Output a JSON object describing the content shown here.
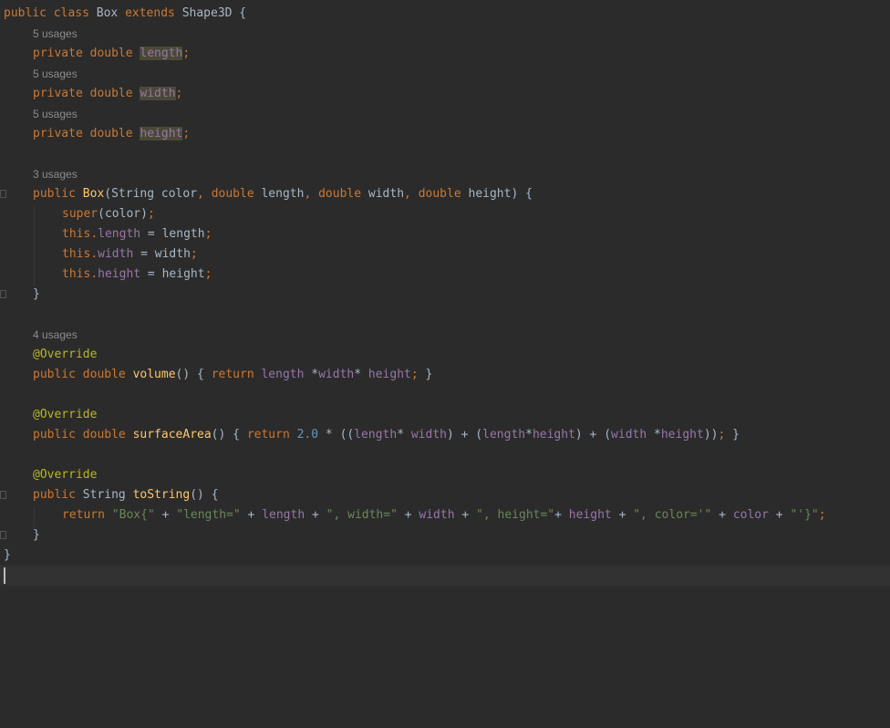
{
  "editor": {
    "language": "Java",
    "lines": {
      "class_decl": {
        "kw1": "public class ",
        "name": "Box ",
        "kw2": "extends ",
        "parent": "Shape3D {"
      },
      "hint_length": "5 usages",
      "field_length": {
        "kw": "private double ",
        "name": "length",
        "semi": ";"
      },
      "hint_width": "5 usages",
      "field_width": {
        "kw": "private double ",
        "name": "width",
        "semi": ";"
      },
      "hint_height": "5 usages",
      "field_height": {
        "kw": "private double ",
        "name": "height",
        "semi": ";"
      },
      "hint_ctor": "3 usages",
      "ctor_decl": {
        "kw": "public ",
        "name": "Box",
        "p1": "(String color",
        "c1": ", ",
        "k1": "double ",
        "p2": "length",
        "c2": ", ",
        "k2": "double ",
        "p3": "width",
        "c3": ", ",
        "k3": "double ",
        "p4": "height) {"
      },
      "super_call": {
        "kw": "super",
        "args": "(color)",
        "semi": ";"
      },
      "assign_length": {
        "kw": "this",
        "dot": ".",
        "field": "length",
        "rest": " = length",
        "semi": ";"
      },
      "assign_width": {
        "kw": "this",
        "dot": ".",
        "field": "width",
        "rest": " = width",
        "semi": ";"
      },
      "assign_height": {
        "kw": "this",
        "dot": ".",
        "field": "height",
        "rest": " = height",
        "semi": ";"
      },
      "ctor_close": "}",
      "hint_volume": "4 usages",
      "ann_volume": "@Override",
      "volume_decl": {
        "kw": "public double ",
        "name": "volume",
        "open": "() { ",
        "ret": "return ",
        "f1": "length",
        "op1": " *",
        "f2": "width",
        "op2": "* ",
        "f3": "height",
        "semi": ";",
        "close": " }"
      },
      "ann_surface": "@Override",
      "surface_decl": {
        "kw": "public double ",
        "name": "surfaceArea",
        "open": "() { ",
        "ret": "return ",
        "num": "2.0",
        "a": " * ((",
        "f1": "length",
        "b": "* ",
        "f2": "width",
        "c": ") + (",
        "f3": "length",
        "d": "*",
        "f4": "height",
        "e": ") + (",
        "f5": "width",
        "f": " *",
        "f6": "height",
        "g": "))",
        "semi": ";",
        "close": " }"
      },
      "ann_tostring": "@Override",
      "tostring_decl": {
        "kw": "public ",
        "type": "String ",
        "name": "toString",
        "rest": "() {"
      },
      "return_line": {
        "ret": "return ",
        "s1": "\"Box{\"",
        "p1": " + ",
        "s2": "\"length=\"",
        "p2": " + ",
        "f1": "length",
        "p3": " + ",
        "s3": "\", width=\"",
        "p4": " + ",
        "f2": "width",
        "p5": " + ",
        "s4": "\", height=\"",
        "p6": "+ ",
        "f3": "height",
        "p7": " + ",
        "s5": "\", color='\"",
        "p8": " + ",
        "f4": "color",
        "p9": " + ",
        "s6": "\"'}\"",
        "semi": ";"
      },
      "method_close": "}",
      "class_close": "}"
    }
  }
}
